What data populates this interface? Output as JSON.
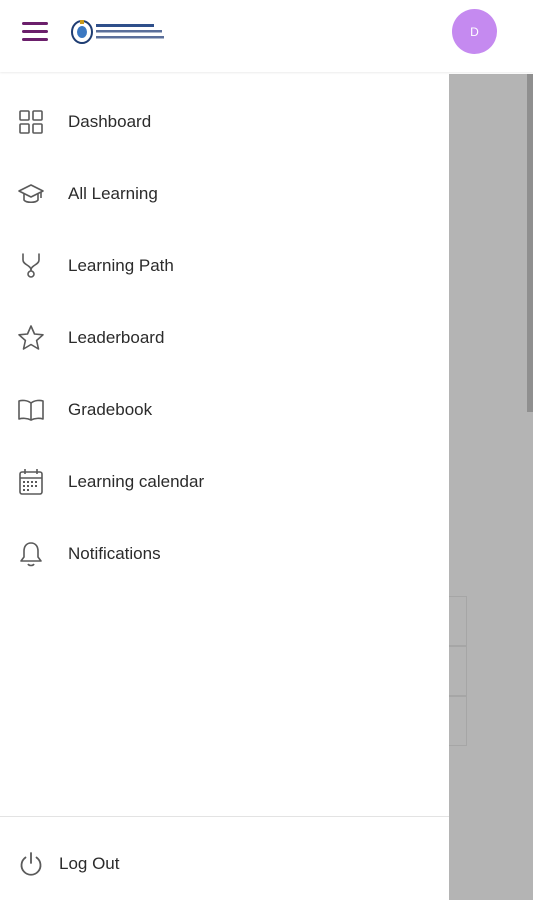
{
  "header": {
    "avatar_initial": "D",
    "icons": {
      "menu": "hamburger-menu-icon",
      "logo": "university-logo"
    }
  },
  "nav": {
    "items": [
      {
        "label": "Dashboard",
        "icon": "dashboard-grid-icon"
      },
      {
        "label": "All Learning",
        "icon": "graduation-cap-icon"
      },
      {
        "label": "Learning Path",
        "icon": "path-branch-icon"
      },
      {
        "label": "Leaderboard",
        "icon": "star-icon"
      },
      {
        "label": "Gradebook",
        "icon": "book-icon"
      },
      {
        "label": "Learning calendar",
        "icon": "calendar-icon"
      },
      {
        "label": "Notifications",
        "icon": "bell-icon"
      }
    ]
  },
  "footer": {
    "logout_label": "Log Out",
    "icon": "power-icon"
  },
  "colors": {
    "accent": "#6b1f6b",
    "avatar_bg": "#c58af0",
    "backdrop": "#b4b4b4",
    "text": "#2b2b2b"
  }
}
